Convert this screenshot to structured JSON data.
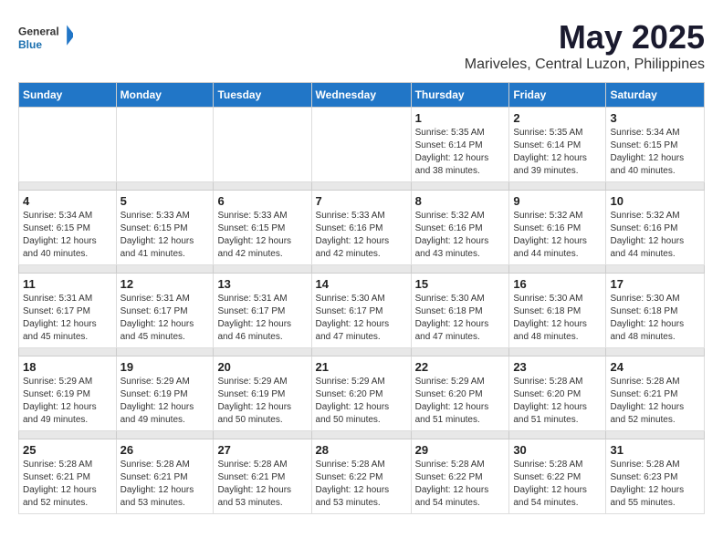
{
  "logo": {
    "text_general": "General",
    "text_blue": "Blue"
  },
  "title": "May 2025",
  "subtitle": "Mariveles, Central Luzon, Philippines",
  "days_of_week": [
    "Sunday",
    "Monday",
    "Tuesday",
    "Wednesday",
    "Thursday",
    "Friday",
    "Saturday"
  ],
  "weeks": [
    [
      {
        "day": "",
        "content": ""
      },
      {
        "day": "",
        "content": ""
      },
      {
        "day": "",
        "content": ""
      },
      {
        "day": "",
        "content": ""
      },
      {
        "day": "1",
        "content": "Sunrise: 5:35 AM\nSunset: 6:14 PM\nDaylight: 12 hours\nand 38 minutes."
      },
      {
        "day": "2",
        "content": "Sunrise: 5:35 AM\nSunset: 6:14 PM\nDaylight: 12 hours\nand 39 minutes."
      },
      {
        "day": "3",
        "content": "Sunrise: 5:34 AM\nSunset: 6:15 PM\nDaylight: 12 hours\nand 40 minutes."
      }
    ],
    [
      {
        "day": "4",
        "content": "Sunrise: 5:34 AM\nSunset: 6:15 PM\nDaylight: 12 hours\nand 40 minutes."
      },
      {
        "day": "5",
        "content": "Sunrise: 5:33 AM\nSunset: 6:15 PM\nDaylight: 12 hours\nand 41 minutes."
      },
      {
        "day": "6",
        "content": "Sunrise: 5:33 AM\nSunset: 6:15 PM\nDaylight: 12 hours\nand 42 minutes."
      },
      {
        "day": "7",
        "content": "Sunrise: 5:33 AM\nSunset: 6:16 PM\nDaylight: 12 hours\nand 42 minutes."
      },
      {
        "day": "8",
        "content": "Sunrise: 5:32 AM\nSunset: 6:16 PM\nDaylight: 12 hours\nand 43 minutes."
      },
      {
        "day": "9",
        "content": "Sunrise: 5:32 AM\nSunset: 6:16 PM\nDaylight: 12 hours\nand 44 minutes."
      },
      {
        "day": "10",
        "content": "Sunrise: 5:32 AM\nSunset: 6:16 PM\nDaylight: 12 hours\nand 44 minutes."
      }
    ],
    [
      {
        "day": "11",
        "content": "Sunrise: 5:31 AM\nSunset: 6:17 PM\nDaylight: 12 hours\nand 45 minutes."
      },
      {
        "day": "12",
        "content": "Sunrise: 5:31 AM\nSunset: 6:17 PM\nDaylight: 12 hours\nand 45 minutes."
      },
      {
        "day": "13",
        "content": "Sunrise: 5:31 AM\nSunset: 6:17 PM\nDaylight: 12 hours\nand 46 minutes."
      },
      {
        "day": "14",
        "content": "Sunrise: 5:30 AM\nSunset: 6:17 PM\nDaylight: 12 hours\nand 47 minutes."
      },
      {
        "day": "15",
        "content": "Sunrise: 5:30 AM\nSunset: 6:18 PM\nDaylight: 12 hours\nand 47 minutes."
      },
      {
        "day": "16",
        "content": "Sunrise: 5:30 AM\nSunset: 6:18 PM\nDaylight: 12 hours\nand 48 minutes."
      },
      {
        "day": "17",
        "content": "Sunrise: 5:30 AM\nSunset: 6:18 PM\nDaylight: 12 hours\nand 48 minutes."
      }
    ],
    [
      {
        "day": "18",
        "content": "Sunrise: 5:29 AM\nSunset: 6:19 PM\nDaylight: 12 hours\nand 49 minutes."
      },
      {
        "day": "19",
        "content": "Sunrise: 5:29 AM\nSunset: 6:19 PM\nDaylight: 12 hours\nand 49 minutes."
      },
      {
        "day": "20",
        "content": "Sunrise: 5:29 AM\nSunset: 6:19 PM\nDaylight: 12 hours\nand 50 minutes."
      },
      {
        "day": "21",
        "content": "Sunrise: 5:29 AM\nSunset: 6:20 PM\nDaylight: 12 hours\nand 50 minutes."
      },
      {
        "day": "22",
        "content": "Sunrise: 5:29 AM\nSunset: 6:20 PM\nDaylight: 12 hours\nand 51 minutes."
      },
      {
        "day": "23",
        "content": "Sunrise: 5:28 AM\nSunset: 6:20 PM\nDaylight: 12 hours\nand 51 minutes."
      },
      {
        "day": "24",
        "content": "Sunrise: 5:28 AM\nSunset: 6:21 PM\nDaylight: 12 hours\nand 52 minutes."
      }
    ],
    [
      {
        "day": "25",
        "content": "Sunrise: 5:28 AM\nSunset: 6:21 PM\nDaylight: 12 hours\nand 52 minutes."
      },
      {
        "day": "26",
        "content": "Sunrise: 5:28 AM\nSunset: 6:21 PM\nDaylight: 12 hours\nand 53 minutes."
      },
      {
        "day": "27",
        "content": "Sunrise: 5:28 AM\nSunset: 6:21 PM\nDaylight: 12 hours\nand 53 minutes."
      },
      {
        "day": "28",
        "content": "Sunrise: 5:28 AM\nSunset: 6:22 PM\nDaylight: 12 hours\nand 53 minutes."
      },
      {
        "day": "29",
        "content": "Sunrise: 5:28 AM\nSunset: 6:22 PM\nDaylight: 12 hours\nand 54 minutes."
      },
      {
        "day": "30",
        "content": "Sunrise: 5:28 AM\nSunset: 6:22 PM\nDaylight: 12 hours\nand 54 minutes."
      },
      {
        "day": "31",
        "content": "Sunrise: 5:28 AM\nSunset: 6:23 PM\nDaylight: 12 hours\nand 55 minutes."
      }
    ]
  ]
}
